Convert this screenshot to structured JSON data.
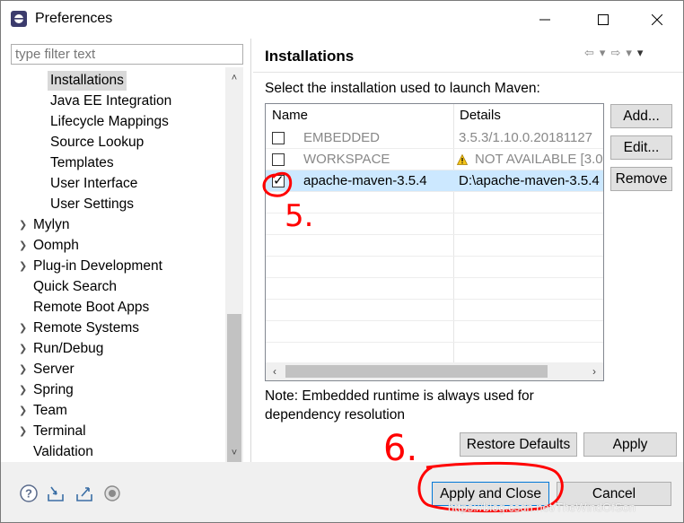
{
  "window": {
    "title": "Preferences"
  },
  "filter": {
    "placeholder": "type filter text"
  },
  "tree": [
    {
      "label": "Installations",
      "selected": true,
      "expandable": false
    },
    {
      "label": "Java EE Integration",
      "expandable": false
    },
    {
      "label": "Lifecycle Mappings",
      "expandable": false
    },
    {
      "label": "Source Lookup",
      "expandable": false
    },
    {
      "label": "Templates",
      "expandable": false
    },
    {
      "label": "User Interface",
      "expandable": false
    },
    {
      "label": "User Settings",
      "expandable": false
    },
    {
      "label": "Mylyn",
      "expandable": true
    },
    {
      "label": "Oomph",
      "expandable": true
    },
    {
      "label": "Plug-in Development",
      "expandable": true
    },
    {
      "label": "Quick Search",
      "expandable": false
    },
    {
      "label": "Remote Boot Apps",
      "expandable": false
    },
    {
      "label": "Remote Systems",
      "expandable": true
    },
    {
      "label": "Run/Debug",
      "expandable": true
    },
    {
      "label": "Server",
      "expandable": true
    },
    {
      "label": "Spring",
      "expandable": true
    },
    {
      "label": "Team",
      "expandable": true
    },
    {
      "label": "Terminal",
      "expandable": true
    },
    {
      "label": "Validation",
      "expandable": false
    }
  ],
  "page": {
    "title": "Installations",
    "description": "Select the installation used to launch Maven:",
    "columns": {
      "name": "Name",
      "details": "Details"
    },
    "rows": [
      {
        "name": "EMBEDDED",
        "details": "3.5.3/1.10.0.20181127",
        "checked": false,
        "greyed": true,
        "warning": false
      },
      {
        "name": "WORKSPACE",
        "details": "NOT AVAILABLE [3.0",
        "checked": false,
        "greyed": true,
        "warning": true
      },
      {
        "name": "apache-maven-3.5.4",
        "details": "D:\\apache-maven-3.5.4",
        "checked": true,
        "greyed": false,
        "warning": false
      }
    ],
    "buttons": {
      "add": "Add...",
      "edit": "Edit...",
      "remove": "Remove"
    },
    "note": "Note: Embedded runtime is always used for dependency resolution",
    "restore_defaults": "Restore Defaults",
    "apply": "Apply"
  },
  "footer": {
    "apply_close": "Apply and Close",
    "cancel": "Cancel",
    "icons": [
      "help-icon",
      "import-icon",
      "export-icon",
      "record-icon"
    ]
  },
  "annotations": {
    "step5": "5.",
    "step6": "6."
  },
  "watermark": "https://blog.csdn.net/TheWindOfSon",
  "colors": {
    "selection": "#cce8ff",
    "annotation": "#ff0000",
    "accent": "#0078d7"
  }
}
